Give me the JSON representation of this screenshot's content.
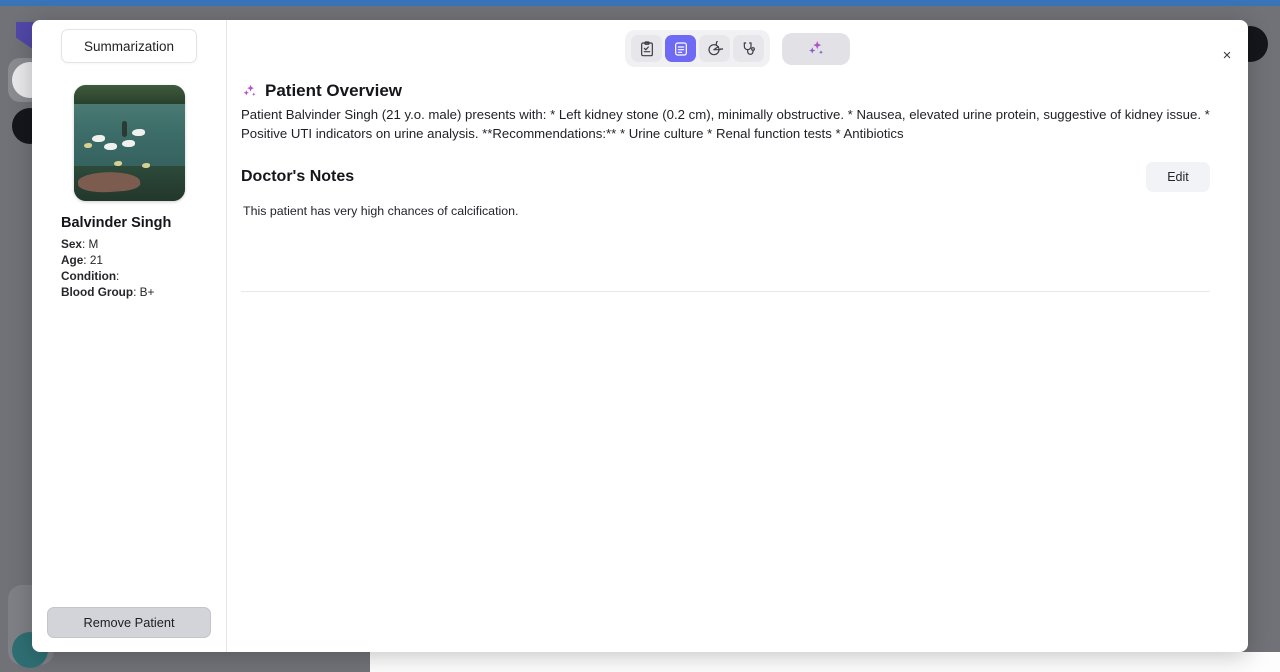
{
  "background": {
    "browser_strip_color": "#3a74b8",
    "backdrop_color": "#717277"
  },
  "modal": {
    "close_icon": "close-icon",
    "close_label": "×"
  },
  "sidebar": {
    "summarize_label": "Summarization",
    "photo_alt": "patient-photo-swans-on-lake",
    "patient_name": "Balvinder Singh",
    "fields": [
      {
        "label": "Sex",
        "value": " M"
      },
      {
        "label": "Age",
        "value": " 21"
      },
      {
        "label": "Condition",
        "value": ""
      },
      {
        "label": "Blood Group",
        "value": " B+"
      }
    ],
    "remove_label": "Remove Patient"
  },
  "toolbar": {
    "buttons": [
      {
        "name": "clipboard-chart-icon",
        "active": false
      },
      {
        "name": "summary-document-icon",
        "active": true
      },
      {
        "name": "pie-chart-icon",
        "active": false
      },
      {
        "name": "stethoscope-icon",
        "active": false
      }
    ],
    "ai_button": {
      "name": "sparkle-ai-icon"
    },
    "active_color": "#6f6af3",
    "group_bg": "#f1f1f4"
  },
  "main": {
    "overview": {
      "icon": "sparkle-icon",
      "title": "Patient Overview",
      "body": "Patient Balvinder Singh (21 y.o. male) presents with: * Left kidney stone (0.2 cm), minimally obstructive. * Nausea, elevated urine protein, suggestive of kidney issue. * Positive UTI indicators on urine analysis. **Recommendations:** * Urine culture * Renal function tests * Antibiotics"
    },
    "notes": {
      "title": "Doctor's Notes",
      "edit_label": "Edit",
      "body": "This patient has very high chances of calcification."
    }
  }
}
